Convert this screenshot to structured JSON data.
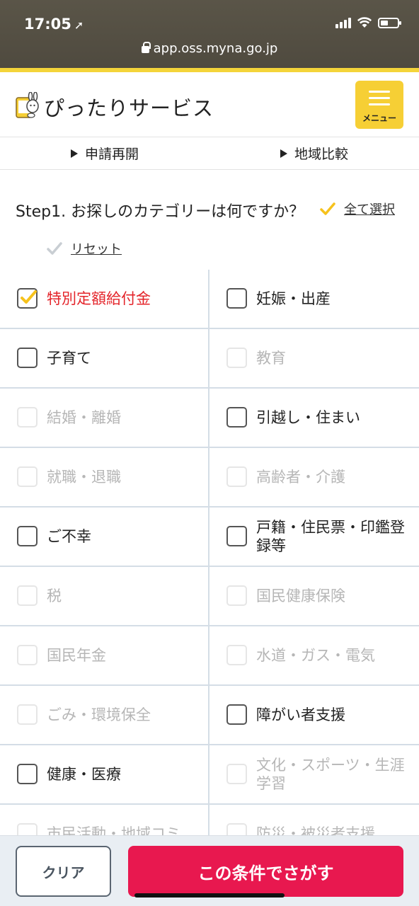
{
  "status_bar": {
    "time": "17:05",
    "url": "app.oss.myna.go.jp"
  },
  "header": {
    "title": "ぴったりサービス",
    "menu_label": "メニュー"
  },
  "subnav": {
    "items": [
      {
        "label": "申請再開"
      },
      {
        "label": "地域比較"
      }
    ]
  },
  "step": {
    "title": "Step1. お探しのカテゴリーは何ですか？",
    "select_all_label": "全て選択",
    "reset_label": "リセット"
  },
  "colors": {
    "accent_yellow": "#f6cf35",
    "primary_button": "#e8184f",
    "checked_label": "#e4242a",
    "disabled_label": "#b6b6b6"
  },
  "categories": [
    [
      {
        "label": "特別定額給付金",
        "state": "checked"
      },
      {
        "label": "妊娠・出産",
        "state": "enabled"
      }
    ],
    [
      {
        "label": "子育て",
        "state": "enabled"
      },
      {
        "label": "教育",
        "state": "disabled"
      }
    ],
    [
      {
        "label": "結婚・離婚",
        "state": "disabled"
      },
      {
        "label": "引越し・住まい",
        "state": "enabled"
      }
    ],
    [
      {
        "label": "就職・退職",
        "state": "disabled"
      },
      {
        "label": "高齢者・介護",
        "state": "disabled"
      }
    ],
    [
      {
        "label": "ご不幸",
        "state": "enabled"
      },
      {
        "label": "戸籍・住民票・印鑑登録等",
        "state": "enabled"
      }
    ],
    [
      {
        "label": "税",
        "state": "disabled"
      },
      {
        "label": "国民健康保険",
        "state": "disabled"
      }
    ],
    [
      {
        "label": "国民年金",
        "state": "disabled"
      },
      {
        "label": "水道・ガス・電気",
        "state": "disabled"
      }
    ],
    [
      {
        "label": "ごみ・環境保全",
        "state": "disabled"
      },
      {
        "label": "障がい者支援",
        "state": "enabled"
      }
    ],
    [
      {
        "label": "健康・医療",
        "state": "enabled"
      },
      {
        "label": "文化・スポーツ・生涯学習",
        "state": "disabled"
      }
    ],
    [
      {
        "label": "市民活動・地域コミ",
        "state": "disabled"
      },
      {
        "label": "防災・被災者支援",
        "state": "disabled"
      }
    ]
  ],
  "bottom_bar": {
    "clear_label": "クリア",
    "search_label": "この条件でさがす"
  }
}
